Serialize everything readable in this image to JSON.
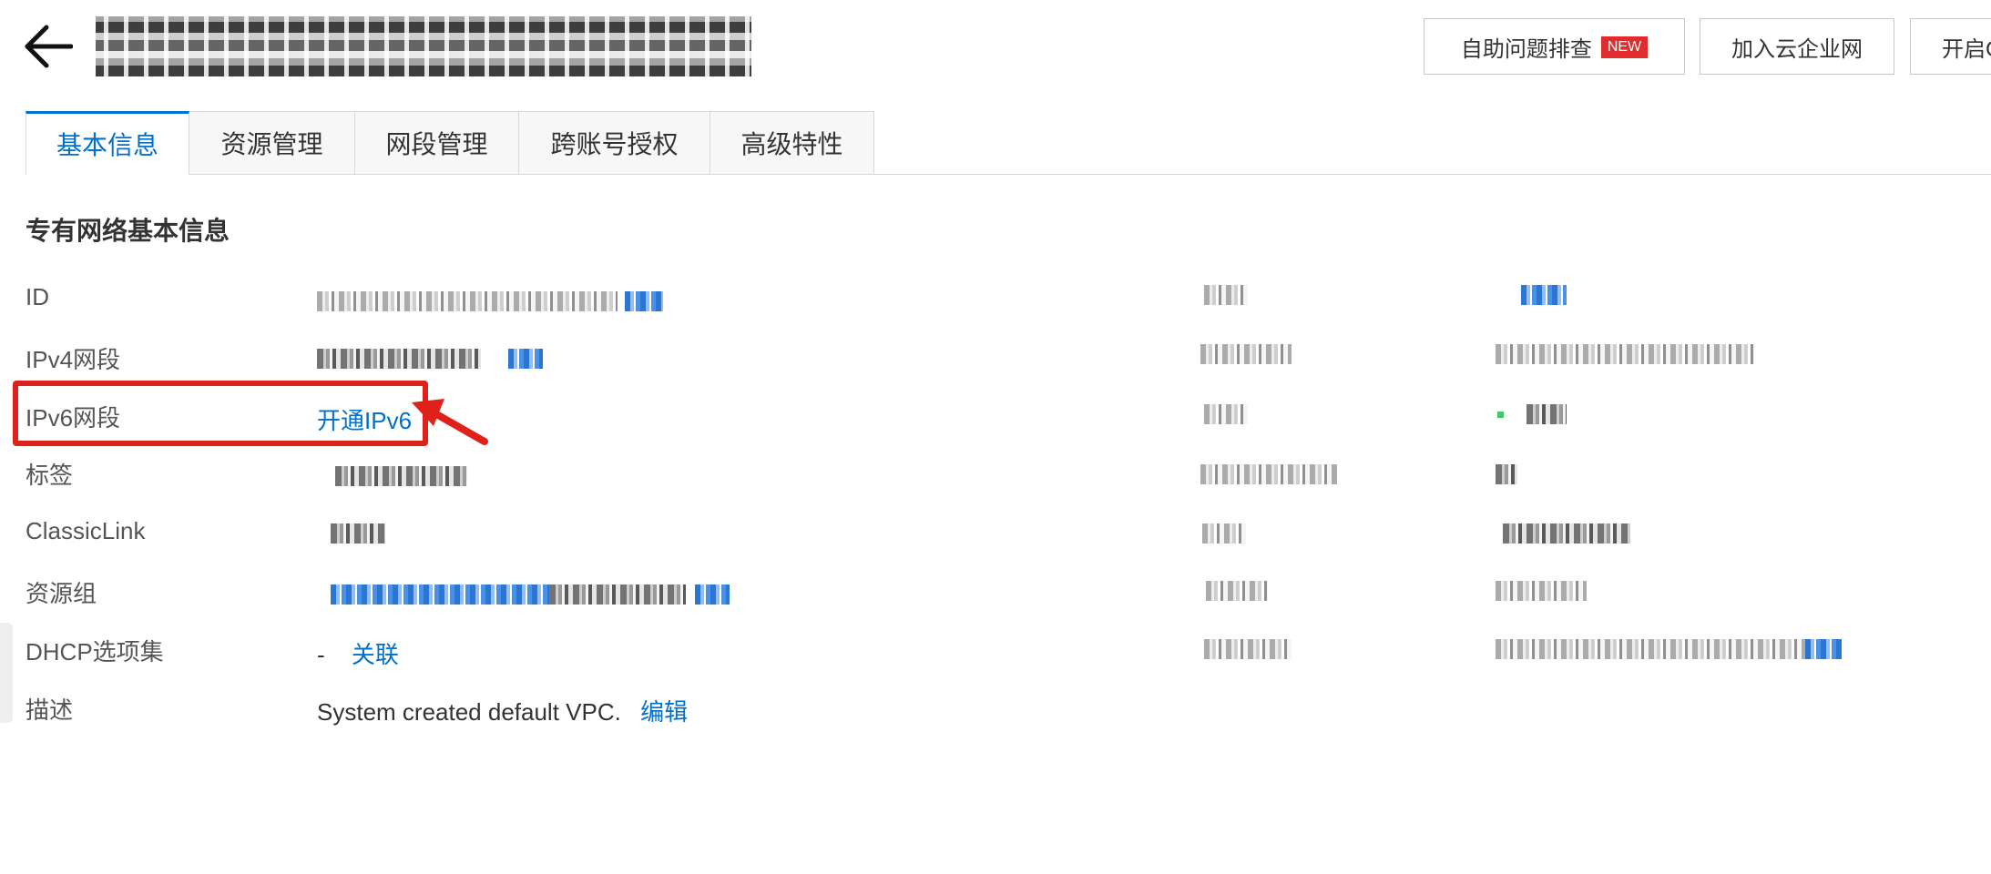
{
  "header": {
    "buttons": {
      "self_help": "自助问题排查",
      "new_badge": "NEW",
      "join_cen": "加入云企业网",
      "open_more": "开启C"
    }
  },
  "tabs": [
    {
      "label": "基本信息",
      "active": true
    },
    {
      "label": "资源管理",
      "active": false
    },
    {
      "label": "网段管理",
      "active": false
    },
    {
      "label": "跨账号授权",
      "active": false
    },
    {
      "label": "高级特性",
      "active": false
    }
  ],
  "section": {
    "title": "专有网络基本信息",
    "rows": {
      "id": {
        "label": "ID"
      },
      "ipv4": {
        "label": "IPv4网段"
      },
      "ipv6": {
        "label": "IPv6网段",
        "action": "开通IPv6"
      },
      "tags": {
        "label": "标签"
      },
      "classiclink": {
        "label": "ClassicLink"
      },
      "resource_group": {
        "label": "资源组"
      },
      "dhcp": {
        "label": "DHCP选项集",
        "value": "-",
        "action": "关联"
      },
      "description": {
        "label": "描述",
        "value": "System created default VPC.",
        "action": "编辑"
      }
    }
  },
  "colors": {
    "accent": "#0070cc",
    "annotation": "#df2219",
    "badge": "#e02c2c"
  },
  "icons": {
    "back": "arrow-left-icon",
    "annotation": "red-arrow-icon"
  }
}
